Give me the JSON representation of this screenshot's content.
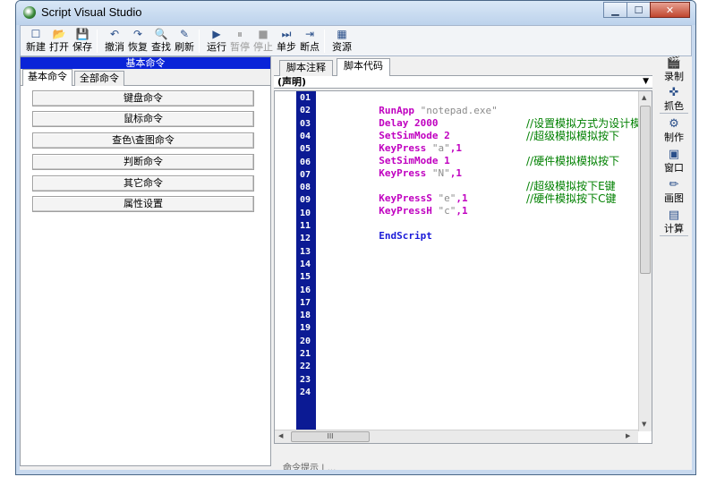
{
  "window": {
    "title": "Script Visual Studio",
    "minimize": "▁",
    "maximize": "☐",
    "close": "✕"
  },
  "toolbar": {
    "new": {
      "label": "新建",
      "icon": "☐"
    },
    "open": {
      "label": "打开",
      "icon": "📂"
    },
    "save": {
      "label": "保存",
      "icon": "💾"
    },
    "undo": {
      "label": "撤消",
      "icon": "↶"
    },
    "redo": {
      "label": "恢复",
      "icon": "↷"
    },
    "find": {
      "label": "查找",
      "icon": "🔍"
    },
    "refresh": {
      "label": "刷新",
      "icon": "✎"
    },
    "run": {
      "label": "运行",
      "icon": "▶"
    },
    "pause": {
      "label": "暂停",
      "icon": "⏸"
    },
    "stop": {
      "label": "停止",
      "icon": "■"
    },
    "step": {
      "label": "单步",
      "icon": "⏭"
    },
    "breakpoint": {
      "label": "断点",
      "icon": "⇥"
    },
    "resources": {
      "label": "资源",
      "icon": "▦"
    }
  },
  "left_panel": {
    "header": "基本命令",
    "tabs": [
      "基本命令",
      "全部命令"
    ],
    "buttons": [
      "键盘命令",
      "鼠标命令",
      "查色\\查图命令",
      "判断命令",
      "其它命令",
      "属性设置"
    ]
  },
  "editor": {
    "tabs": [
      "脚本注释",
      "脚本代码"
    ],
    "active_tab": "脚本代码",
    "declaration": "(声明)",
    "declaration_arrow": "▼",
    "line_numbers": [
      "01",
      "02",
      "03",
      "04",
      "05",
      "06",
      "07",
      "08",
      "09",
      "10",
      "11",
      "12",
      "13",
      "14",
      "15",
      "16",
      "17",
      "18",
      "19",
      "20",
      "21",
      "22",
      "23",
      "24"
    ],
    "code": {
      "l1": {
        "cmd": "RunApp ",
        "arg": "\"notepad.exe\""
      },
      "l2": {
        "cmd": "Delay ",
        "arg": "2000"
      },
      "l3": {
        "cmd": "SetSimMode ",
        "arg": "2",
        "comment": "//设置模拟方式为设计模拟"
      },
      "l4": {
        "cmd": "KeyPress ",
        "arg": "\"a\"",
        "arg2": ",1",
        "comment": "//超级模拟模拟按下"
      },
      "l5": {
        "cmd": "SetSimMode ",
        "arg": "1"
      },
      "l6": {
        "cmd": "KeyPress ",
        "arg": "\"N\"",
        "arg2": ",1",
        "comment": "//硬件模拟模拟按下"
      },
      "l8": {
        "cmd": "KeyPressS ",
        "arg": "\"e\"",
        "arg2": ",1",
        "comment": "//超级模拟按下E键"
      },
      "l9": {
        "cmd": "KeyPressH ",
        "arg": "\"c\"",
        "arg2": ",1",
        "comment": "//硬件模拟按下C键"
      },
      "l11": {
        "cmd": "EndScript"
      }
    },
    "hscroll_thumb": "III",
    "status": "命令提示 | ..."
  },
  "right_tools": [
    {
      "label": "录制",
      "icon": "🎬"
    },
    {
      "label": "抓色",
      "icon": "✜"
    },
    {
      "label": "制作",
      "icon": "⚙"
    },
    {
      "label": "窗口",
      "icon": "▣"
    },
    {
      "label": "画图",
      "icon": "✏"
    },
    {
      "label": "计算",
      "icon": "▤"
    }
  ],
  "colors": {
    "gutter": "#0b1a94",
    "panel_header": "#0a24d8",
    "keyword": "#c000c0",
    "comment": "#008000",
    "endscript": "#1a1ad8"
  }
}
